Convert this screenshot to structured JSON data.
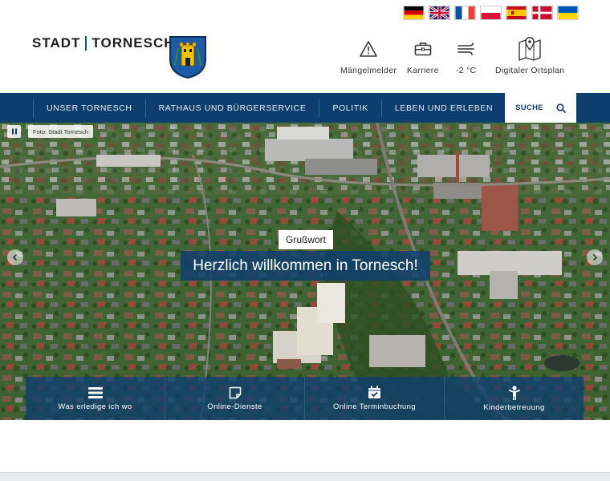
{
  "header": {
    "logo_text_left": "STADT",
    "logo_text_right": "TORNESCH",
    "languages": [
      {
        "name": "de-flag-icon"
      },
      {
        "name": "gb-flag-icon"
      },
      {
        "name": "fr-flag-icon"
      },
      {
        "name": "pl-flag-icon"
      },
      {
        "name": "es-flag-icon"
      },
      {
        "name": "dk-flag-icon"
      },
      {
        "name": "ua-flag-icon"
      }
    ],
    "quick_links": {
      "maengelmelder": "Mängelmelder",
      "karriere": "Karriere",
      "weather": "-2 °C",
      "ortsplan": "Digitaler Ortsplan"
    }
  },
  "nav": {
    "items": [
      "UNSER TORNESCH",
      "RATHAUS UND BÜRGERSERVICE",
      "POLITIK",
      "LEBEN UND ERLEBEN"
    ],
    "search_label": "SUCHE"
  },
  "hero": {
    "photo_credit": "Foto: Stadt Tornesch",
    "button_label": "Grußwort",
    "headline": "Herzlich willkommen in Tornesch!"
  },
  "tiles": [
    "Was erledige ich wo",
    "Online-Dienste",
    "Online Terminbuchung",
    "Kinderbetreuung"
  ],
  "colors": {
    "primary": "#0e3e6e",
    "accent": "#0e4c8a"
  }
}
